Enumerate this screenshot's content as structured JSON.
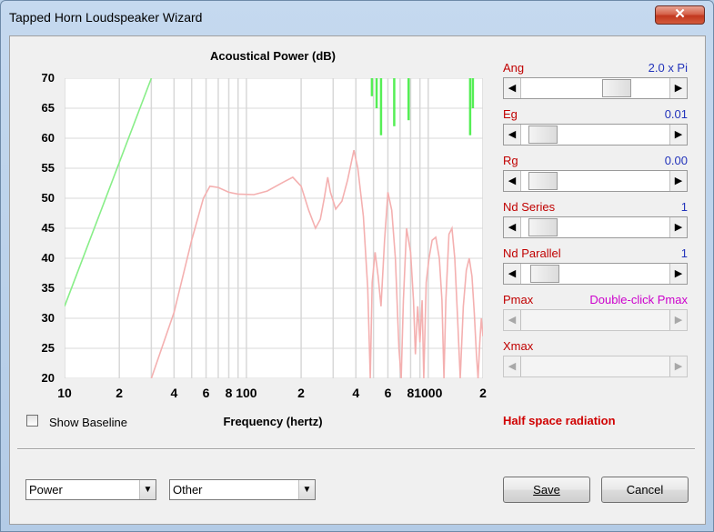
{
  "window": {
    "title": "Tapped Horn Loudspeaker Wizard",
    "close_glyph": "✕"
  },
  "chart_data": {
    "type": "line",
    "title": "Acoustical Power (dB)",
    "xlabel": "Frequency (hertz)",
    "ylabel": "",
    "x_scale": "log",
    "xlim": [
      10,
      2000
    ],
    "ylim": [
      20,
      70
    ],
    "grid": true,
    "y_ticks": [
      "70",
      "65",
      "60",
      "55",
      "50",
      "45",
      "40",
      "35",
      "30",
      "25",
      "20"
    ],
    "x_ticks": [
      {
        "v": 10,
        "label": "10"
      },
      {
        "v": 20,
        "label": "2"
      },
      {
        "v": 40,
        "label": "4"
      },
      {
        "v": 60,
        "label": "6"
      },
      {
        "v": 80,
        "label": "8"
      },
      {
        "v": 100,
        "label": "100"
      },
      {
        "v": 200,
        "label": "2"
      },
      {
        "v": 400,
        "label": "4"
      },
      {
        "v": 600,
        "label": "6"
      },
      {
        "v": 800,
        "label": "8"
      },
      {
        "v": 1000,
        "label": "1000"
      },
      {
        "v": 2000,
        "label": "2"
      }
    ],
    "series": [
      {
        "color": "#88ee88",
        "points": [
          [
            10,
            32
          ],
          [
            30,
            70
          ]
        ]
      },
      {
        "color": "#f4b0b0",
        "points": [
          [
            30,
            20
          ],
          [
            40,
            31
          ],
          [
            50,
            43
          ],
          [
            58,
            50
          ],
          [
            63,
            52
          ],
          [
            70,
            51.8
          ],
          [
            80,
            51
          ],
          [
            90,
            50.7
          ],
          [
            110,
            50.6
          ],
          [
            130,
            51.2
          ],
          [
            160,
            52.7
          ],
          [
            180,
            53.5
          ],
          [
            200,
            52
          ],
          [
            220,
            48
          ],
          [
            240,
            45
          ],
          [
            255,
            46.5
          ],
          [
            268,
            50
          ],
          [
            280,
            53.5
          ],
          [
            290,
            51
          ],
          [
            310,
            48.2
          ],
          [
            335,
            49.5
          ],
          [
            360,
            53
          ],
          [
            390,
            58
          ],
          [
            410,
            55
          ],
          [
            440,
            47
          ],
          [
            465,
            35
          ],
          [
            480,
            20
          ],
          [
            492,
            36
          ],
          [
            510,
            41
          ],
          [
            530,
            37
          ],
          [
            550,
            32
          ],
          [
            575,
            43
          ],
          [
            600,
            51
          ],
          [
            630,
            48
          ],
          [
            660,
            40
          ],
          [
            690,
            25
          ],
          [
            710,
            20
          ],
          [
            730,
            33
          ],
          [
            760,
            45
          ],
          [
            800,
            41
          ],
          [
            830,
            33
          ],
          [
            850,
            24
          ],
          [
            875,
            32
          ],
          [
            900,
            26
          ],
          [
            925,
            33
          ],
          [
            945,
            20
          ],
          [
            975,
            36
          ],
          [
            1010,
            40
          ],
          [
            1050,
            43
          ],
          [
            1100,
            43.5
          ],
          [
            1150,
            40
          ],
          [
            1190,
            33
          ],
          [
            1220,
            20
          ],
          [
            1250,
            33
          ],
          [
            1300,
            44
          ],
          [
            1350,
            45
          ],
          [
            1400,
            40
          ],
          [
            1450,
            30
          ],
          [
            1500,
            20
          ],
          [
            1560,
            32
          ],
          [
            1620,
            38
          ],
          [
            1680,
            40
          ],
          [
            1740,
            37
          ],
          [
            1790,
            31
          ],
          [
            1840,
            24
          ],
          [
            1880,
            20
          ],
          [
            1920,
            26
          ],
          [
            1960,
            30
          ],
          [
            2000,
            27
          ]
        ]
      }
    ],
    "spikes": [
      {
        "x": 490,
        "from": 70,
        "to": 67
      },
      {
        "x": 520,
        "from": 70,
        "to": 65
      },
      {
        "x": 550,
        "from": 70,
        "to": 60.5
      },
      {
        "x": 650,
        "from": 70,
        "to": 62
      },
      {
        "x": 780,
        "from": 70,
        "to": 63
      },
      {
        "x": 1700,
        "from": 70,
        "to": 60.5
      },
      {
        "x": 1760,
        "from": 70,
        "to": 65
      }
    ],
    "spike_color": "#55ee55"
  },
  "show_baseline": {
    "label": "Show Baseline",
    "checked": false
  },
  "params": [
    {
      "label": "Ang",
      "value": "2.0 x Pi",
      "thumb": 0.68,
      "enabled": true,
      "value_color": "#2233bb"
    },
    {
      "label": "Eg",
      "value": "0.01",
      "thumb": 0.06,
      "enabled": true,
      "value_color": "#2233bb"
    },
    {
      "label": "Rg",
      "value": "0.00",
      "thumb": 0.06,
      "enabled": true,
      "value_color": "#2233bb"
    },
    {
      "label": "Nd  Series",
      "value": "1",
      "thumb": 0.06,
      "enabled": true,
      "value_color": "#2233bb"
    },
    {
      "label": "Nd  Parallel",
      "value": "1",
      "thumb": 0.08,
      "enabled": true,
      "value_color": "#2233bb"
    },
    {
      "label": "Pmax",
      "value": "Double-click Pmax",
      "thumb": null,
      "enabled": false,
      "value_color": "#cc00cc"
    },
    {
      "label": "Xmax",
      "value": "",
      "thumb": null,
      "enabled": false,
      "value_color": "#2233bb"
    }
  ],
  "radiation_note": "Half space radiation",
  "combos": {
    "left": "Power",
    "right": "Other"
  },
  "buttons": {
    "save": "Save",
    "cancel": "Cancel"
  }
}
